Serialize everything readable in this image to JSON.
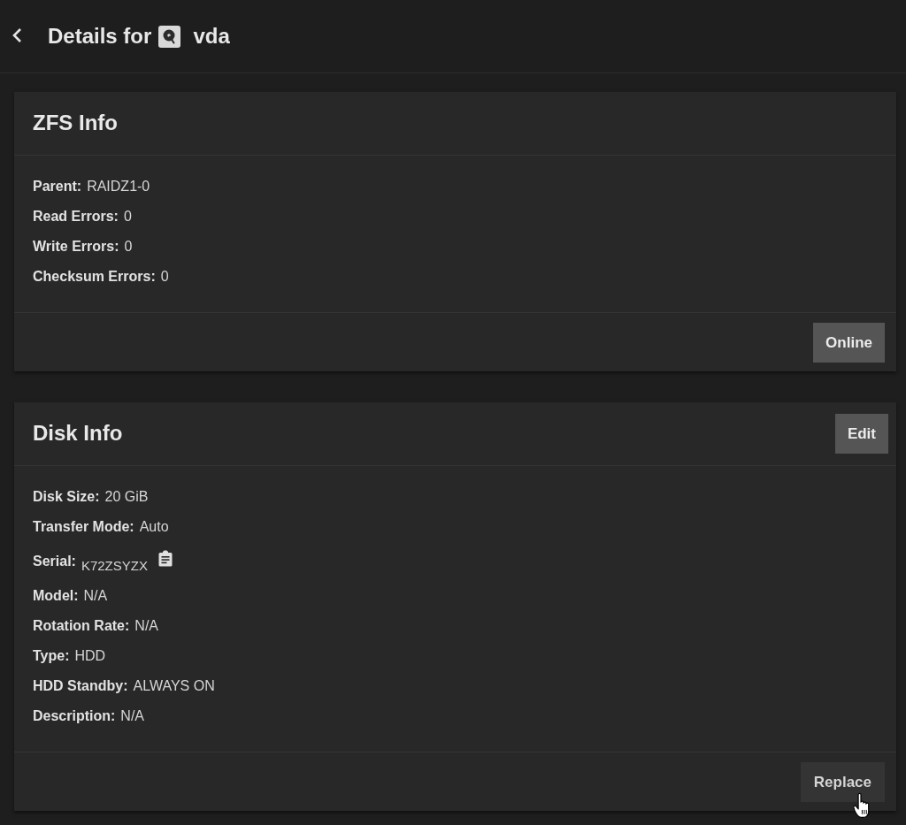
{
  "header": {
    "title": "Details for",
    "device": "vda"
  },
  "cards": [
    {
      "title": "ZFS Info",
      "fields": [
        {
          "kind": "text",
          "label": "Parent:",
          "value": "RAIDZ1-0"
        },
        {
          "kind": "text",
          "label": "Read Errors:",
          "value": "0"
        },
        {
          "kind": "text",
          "label": "Write Errors:",
          "value": "0"
        },
        {
          "kind": "text",
          "label": "Checksum Errors:",
          "value": "0"
        }
      ],
      "footer_buttons": [
        {
          "label": "Online",
          "kind": "raised",
          "hovered": false
        }
      ]
    },
    {
      "title": "Disk Info",
      "header_button": {
        "label": "Edit",
        "kind": "raised"
      },
      "fields": [
        {
          "kind": "text",
          "label": "Disk Size:",
          "value": "20 GiB"
        },
        {
          "kind": "text",
          "label": "Transfer Mode:",
          "value": "Auto"
        },
        {
          "kind": "copyable",
          "label": "Serial:",
          "value": "K72ZSYZX"
        },
        {
          "kind": "text",
          "label": "Model:",
          "value": "N/A"
        },
        {
          "kind": "text",
          "label": "Rotation Rate:",
          "value": "N/A"
        },
        {
          "kind": "text",
          "label": "Type:",
          "value": "HDD"
        },
        {
          "kind": "text",
          "label": "HDD Standby:",
          "value": "ALWAYS ON"
        },
        {
          "kind": "text",
          "label": "Description:",
          "value": "N/A"
        }
      ],
      "footer_buttons": [
        {
          "label": "Replace",
          "kind": "flat",
          "hovered": true
        }
      ]
    }
  ]
}
